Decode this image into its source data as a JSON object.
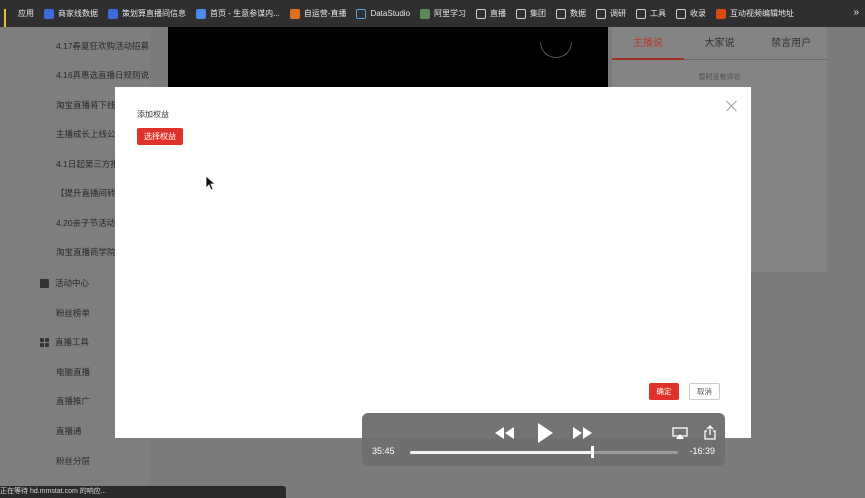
{
  "bookmarks": {
    "items": [
      {
        "label": "应用",
        "icon": "apps-grid-icon"
      },
      {
        "label": "商家线数据",
        "icon": "bookmark-doc-icon"
      },
      {
        "label": "策划算直播间信息",
        "icon": "bookmark-doc-icon"
      },
      {
        "label": "首页 - 生意参谋内...",
        "icon": "bookmark-site-icon"
      },
      {
        "label": "自运营-直播",
        "icon": "bookmark-site-icon"
      },
      {
        "label": "DataStudio",
        "icon": "datastudio-icon"
      },
      {
        "label": "阿里学习",
        "icon": "bookmark-site-icon"
      },
      {
        "label": "直播",
        "icon": "folder-icon"
      },
      {
        "label": "集团",
        "icon": "folder-icon"
      },
      {
        "label": "数据",
        "icon": "folder-icon"
      },
      {
        "label": "调研",
        "icon": "folder-icon"
      },
      {
        "label": "工具",
        "icon": "folder-icon"
      },
      {
        "label": "收录",
        "icon": "folder-icon"
      },
      {
        "label": "互动视频编辑地址",
        "icon": "bookmark-site-icon"
      }
    ],
    "more": "»"
  },
  "sidebar": {
    "items": [
      {
        "label": "4.17春夏狂欢购活动招募"
      },
      {
        "label": "4.16真惠选直播日规则说"
      },
      {
        "label": "淘宝直播将下线"
      },
      {
        "label": "主播成长上线公"
      },
      {
        "label": "4.1日起第三方推"
      },
      {
        "label": "【提升直播间转"
      },
      {
        "label": "4.20亲子节活动"
      },
      {
        "label": "淘宝直播商学院"
      }
    ],
    "section_activity": "活动中心",
    "item_fans_rank": "粉丝榜单",
    "section_tools": "直播工具",
    "tools": [
      {
        "label": "电脑直播"
      },
      {
        "label": "直播推广"
      },
      {
        "label": "直播通"
      },
      {
        "label": "粉丝分层"
      }
    ]
  },
  "comments": {
    "tabs": [
      "主播说",
      "大家说",
      "禁言用户"
    ],
    "empty_text": "暂时没有评论"
  },
  "modal": {
    "title": "添加权益",
    "select_button": "选择权益",
    "ok_button": "确定",
    "cancel_button": "取消"
  },
  "player": {
    "elapsed": "35:45",
    "remaining": "-16:39",
    "progress": 0.68
  },
  "status_bar": {
    "text": "正在等待 hd.mmstat.com 的响应..."
  },
  "colors": {
    "accent": "#e0322b",
    "bookmark_bar": "#2f2f2f",
    "overlay": "#7b7b7b"
  }
}
